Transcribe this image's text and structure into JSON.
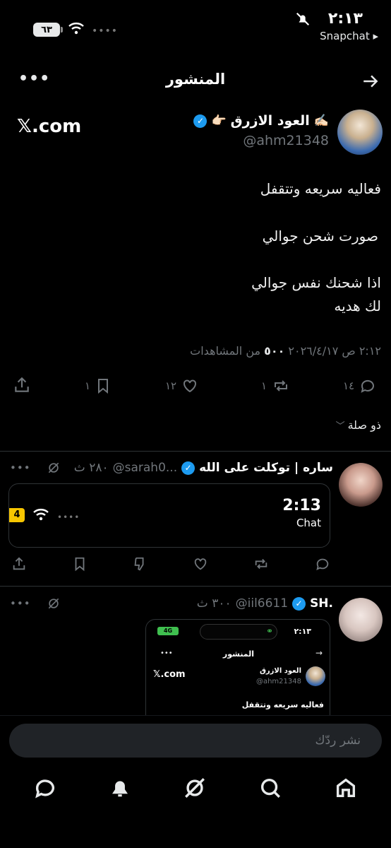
{
  "status": {
    "battery": "٦٣",
    "time": "٢:١٣",
    "back_app": "Snapchat ▸"
  },
  "header": {
    "title": "المنشور"
  },
  "post": {
    "author_name": "العود الازرق",
    "handle": "@ahm21348",
    "brand": "𝕏.com",
    "line1": "فعاليه سريعه وتتقفل",
    "line2": "صورت شحن جوالي",
    "line3": "اذا شحنك نفس جوالي",
    "line4": "لك هديه",
    "meta": "٢:١٢ ص ٢٠٢٦/٤/١٧ ٥٠٠ من المشاهدات",
    "meta_date": "٢:١٢ ص ٢٠٢٦/٤/١٧",
    "meta_views_num": "٥٠٠",
    "meta_views_label": "من المشاهدات",
    "replies": "١٤",
    "reposts": "١",
    "likes": "١٢",
    "bookmarks": "١",
    "related": "ذو صلة"
  },
  "reply1": {
    "name": "ساره | توكلت على الله",
    "handle": "@sarah0...",
    "age": "٢٨٠ ث",
    "screenshot_time": "2:13",
    "screenshot_app": "Chat",
    "screenshot_badge": "4"
  },
  "reply2": {
    "name": "SH.",
    "handle": "@iil6611",
    "age": "٣٠٠ ث",
    "mini_time": "٢:١٣",
    "mini_title": "المنشور",
    "mini_author": "العود الازرق",
    "mini_handle": "@ahm21348",
    "mini_brand": "𝕏.com",
    "mini_text": "فعاليه سريعه وتتقفل"
  },
  "composer": {
    "placeholder": "نشر ردّك"
  },
  "nav": {
    "items": [
      "home-icon",
      "search-icon",
      "grok-icon",
      "notifications-icon",
      "messages-icon"
    ]
  },
  "colors": {
    "accent": "#1d9bf0",
    "background": "#000000",
    "muted": "#71767b"
  }
}
